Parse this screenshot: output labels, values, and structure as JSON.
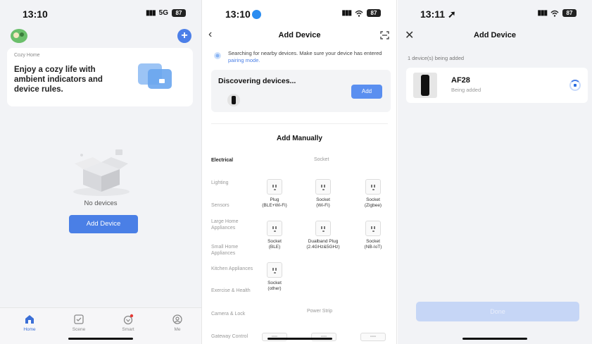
{
  "colors": {
    "accent": "#4a7fe6",
    "page_bg": "#f2f3f6"
  },
  "screen1": {
    "status": {
      "time": "13:10",
      "signal": "5G",
      "battery": "87"
    },
    "banner": {
      "tag": "Cozy Home",
      "message": "Enjoy a cozy life with ambient indicators and device rules."
    },
    "empty_text": "No devices",
    "add_button": "Add Device",
    "tabs": [
      {
        "label": "Home",
        "icon": "home-icon"
      },
      {
        "label": "Scene",
        "icon": "scene-icon"
      },
      {
        "label": "Smart",
        "icon": "smart-icon"
      },
      {
        "label": "Me",
        "icon": "me-icon"
      }
    ]
  },
  "screen2": {
    "status": {
      "time": "13:10",
      "battery": "87"
    },
    "title": "Add Device",
    "search_text": "Searching for nearby devices. Make sure your device has entered",
    "search_link": "pairing mode.",
    "discover_title": "Discovering devices...",
    "discover_add": "Add",
    "add_manually": "Add Manually",
    "categories": [
      "Electrical",
      "Lighting",
      "Sensors",
      "Large Home Appliances",
      "Small Home Appliances",
      "Kitchen Appliances",
      "Exercise & Health",
      "Camera & Lock",
      "Gateway Control"
    ],
    "section_socket": "Socket",
    "section_power_strip": "Power Strip",
    "devices": [
      {
        "name": "Plug",
        "sub": "(BLE+Wi-Fi)"
      },
      {
        "name": "Socket",
        "sub": "(Wi-Fi)"
      },
      {
        "name": "Socket",
        "sub": "(Zigbee)"
      },
      {
        "name": "Socket",
        "sub": "(BLE)"
      },
      {
        "name": "Dualband Plug",
        "sub": "(2.4GHz&5GHz)"
      },
      {
        "name": "Socket",
        "sub": "(NB-IoT)"
      },
      {
        "name": "Socket",
        "sub": "(other)"
      }
    ]
  },
  "screen3": {
    "status": {
      "time": "13:11",
      "battery": "87"
    },
    "title": "Add Device",
    "count_text": "1 device(s) being added",
    "device_name": "AF28",
    "device_state": "Being added",
    "done_button": "Done"
  }
}
